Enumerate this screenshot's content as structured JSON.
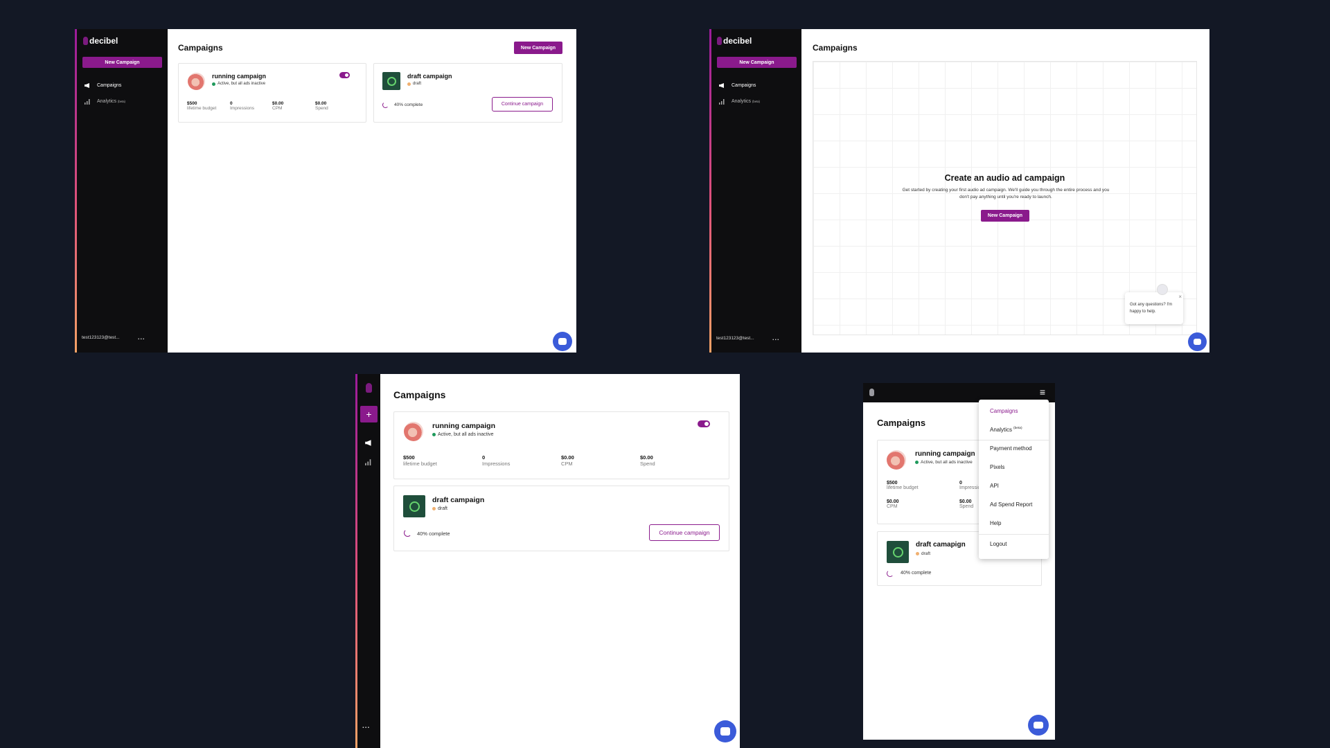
{
  "brand": {
    "name": "decibel",
    "accent": "#8a1a8c",
    "background": "#131825"
  },
  "sidebar": {
    "new_campaign_label": "New Campaign",
    "nav_campaigns": "Campaigns",
    "nav_analytics": "Analytics",
    "beta_tag": "(beta)",
    "user_email": "test123123@test...",
    "more_label": "..."
  },
  "header": {
    "title": "Campaigns",
    "new_campaign_label": "New Campaign"
  },
  "campaigns": [
    {
      "name": "running campaign",
      "status": "Active, but all ads inactive",
      "status_color": "#1f9a5c",
      "toggle_on": true,
      "stats": [
        {
          "value": "$500",
          "label": "lifetime budget"
        },
        {
          "value": "0",
          "label": "Impressions"
        },
        {
          "value": "$0.00",
          "label": "CPM"
        },
        {
          "value": "$0.00",
          "label": "Spend"
        }
      ]
    },
    {
      "name": "draft campaign",
      "status": "draft",
      "status_color": "#f0b070",
      "progress_text": "40% complete",
      "progress_value": 0.4,
      "continue_label": "Continue campaign"
    }
  ],
  "empty_state": {
    "title": "Create an audio ad campaign",
    "description": "Get started by creating your first audio ad campaign. We'll guide you through the entire process and you don't pay anything until you're ready to launch.",
    "button_label": "New Campaign",
    "chat_popup_text": "Got any questions? I'm happy to help.",
    "close_label": "×"
  },
  "mobile": {
    "draft_name": "draft camapign",
    "menu_items": [
      "Campaigns",
      "Analytics",
      "Payment method",
      "Pixels",
      "API",
      "Ad Spend Report",
      "Help",
      "Logout"
    ]
  },
  "icons": {
    "plus": "+",
    "menu": "≡",
    "campaigns": "megaphone-icon",
    "analytics": "bar-chart-icon",
    "chat": "chat-icon"
  }
}
